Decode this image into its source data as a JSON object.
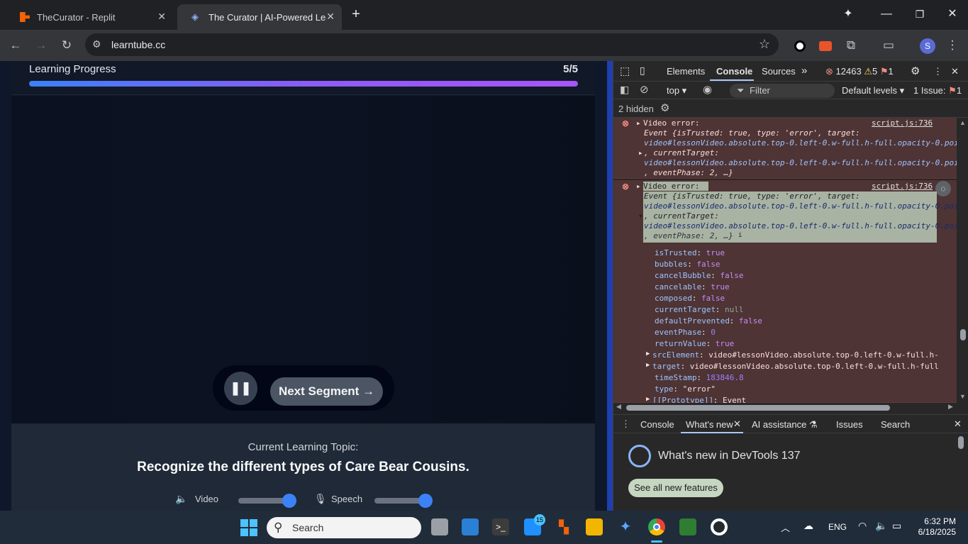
{
  "browser": {
    "tabs": [
      {
        "title": "TheCurator - Replit",
        "active": false
      },
      {
        "title": "The Curator | AI-Powered Learn",
        "active": true
      }
    ],
    "new_tab_glyph": "+",
    "url": "learntube.cc",
    "profile_initial": "S",
    "window_controls": {
      "minimize": "—",
      "maximize": "❐",
      "close": "✕"
    }
  },
  "page": {
    "progress_label": "Learning Progress",
    "progress_count": "5/5",
    "progress_fraction": 1.0,
    "pause_glyph": "❚❚",
    "next_button": "Next Segment →",
    "topic_label": "Current Learning Topic:",
    "topic_title": "Recognize the different types of Care Bear Cousins.",
    "video_label": "Video",
    "speech_label": "Speech",
    "video_volume": 0.9,
    "speech_volume": 0.9
  },
  "devtools": {
    "tabs": [
      "Elements",
      "Console",
      "Sources"
    ],
    "active_tab": "Console",
    "more_tabs": "»",
    "error_count": "12463",
    "warning_count": "5",
    "issue_count": "1",
    "context": "top ▾",
    "filter_placeholder": "Filter",
    "levels": "Default levels ▾",
    "issues_label": "1 Issue:",
    "issues_count": "1",
    "hidden_label": "2 hidden",
    "log": {
      "entry1": {
        "title": "Video error:",
        "source": "script.js:736",
        "line1": "Event {isTrusted: true, type: 'error', target:",
        "line2": "video#lessonVideo.absolute.top-0.left-0.w-full.h-full.opacity-0.poi",
        "line3": ", currentTarget:",
        "line4": "video#lessonVideo.absolute.top-0.left-0.w-full.h-full.opacity-0.poi",
        "line5": ", eventPhase: 2, …}"
      },
      "entry2": {
        "title": "Video error:",
        "source": "script.js:736",
        "line1": "Event {isTrusted: true, type: 'error', target:",
        "line2": "video#lessonVideo.absolute.top-0.left-0.w-full.h-full.opacity-0.poi",
        "line3": ", currentTarget:",
        "line4": "video#lessonVideo.absolute.top-0.left-0.w-full.h-full.opacity-0.poi",
        "line5": ", eventPhase: 2, …}",
        "info_badge": "i"
      },
      "props": [
        {
          "key": "isTrusted",
          "value": "true",
          "kind": "kw",
          "expandable": false
        },
        {
          "key": "bubbles",
          "value": "false",
          "kind": "kw",
          "expandable": false
        },
        {
          "key": "cancelBubble",
          "value": "false",
          "kind": "kw",
          "expandable": false
        },
        {
          "key": "cancelable",
          "value": "true",
          "kind": "kw",
          "expandable": false
        },
        {
          "key": "composed",
          "value": "false",
          "kind": "kw",
          "expandable": false
        },
        {
          "key": "currentTarget",
          "value": "null",
          "kind": "nul",
          "expandable": false
        },
        {
          "key": "defaultPrevented",
          "value": "false",
          "kind": "kw",
          "expandable": false
        },
        {
          "key": "eventPhase",
          "value": "0",
          "kind": "num",
          "expandable": false
        },
        {
          "key": "returnValue",
          "value": "true",
          "kind": "kw",
          "expandable": false
        },
        {
          "key": "srcElement",
          "value": "video#lessonVideo.absolute.top-0.left-0.w-full.h-",
          "kind": "plain",
          "expandable": true
        },
        {
          "key": "target",
          "value": "video#lessonVideo.absolute.top-0.left-0.w-full.h-full",
          "kind": "plain",
          "expandable": true
        },
        {
          "key": "timeStamp",
          "value": "183846.8",
          "kind": "num",
          "expandable": false
        },
        {
          "key": "type",
          "value": "\"error\"",
          "kind": "plain",
          "expandable": false
        },
        {
          "key": "[[Prototype]]",
          "value": "Event",
          "kind": "plain",
          "expandable": true
        }
      ]
    },
    "drawer_tabs": [
      "Console",
      "What's new",
      "AI assistance",
      "Issues",
      "Search"
    ],
    "drawer_active": "What's new",
    "whats_new_title": "What's new in DevTools 137",
    "whats_new_button": "See all new features"
  },
  "taskbar": {
    "search_placeholder": "Search",
    "badge_count": "15",
    "language": "ENG",
    "time": "6:32 PM",
    "date": "6/18/2025"
  },
  "colors": {
    "progress_gradient_start": "#3b82f6",
    "progress_gradient_end": "#a855f7",
    "slider_knob": "#3b82f6",
    "error_bg": "#4e3434"
  }
}
